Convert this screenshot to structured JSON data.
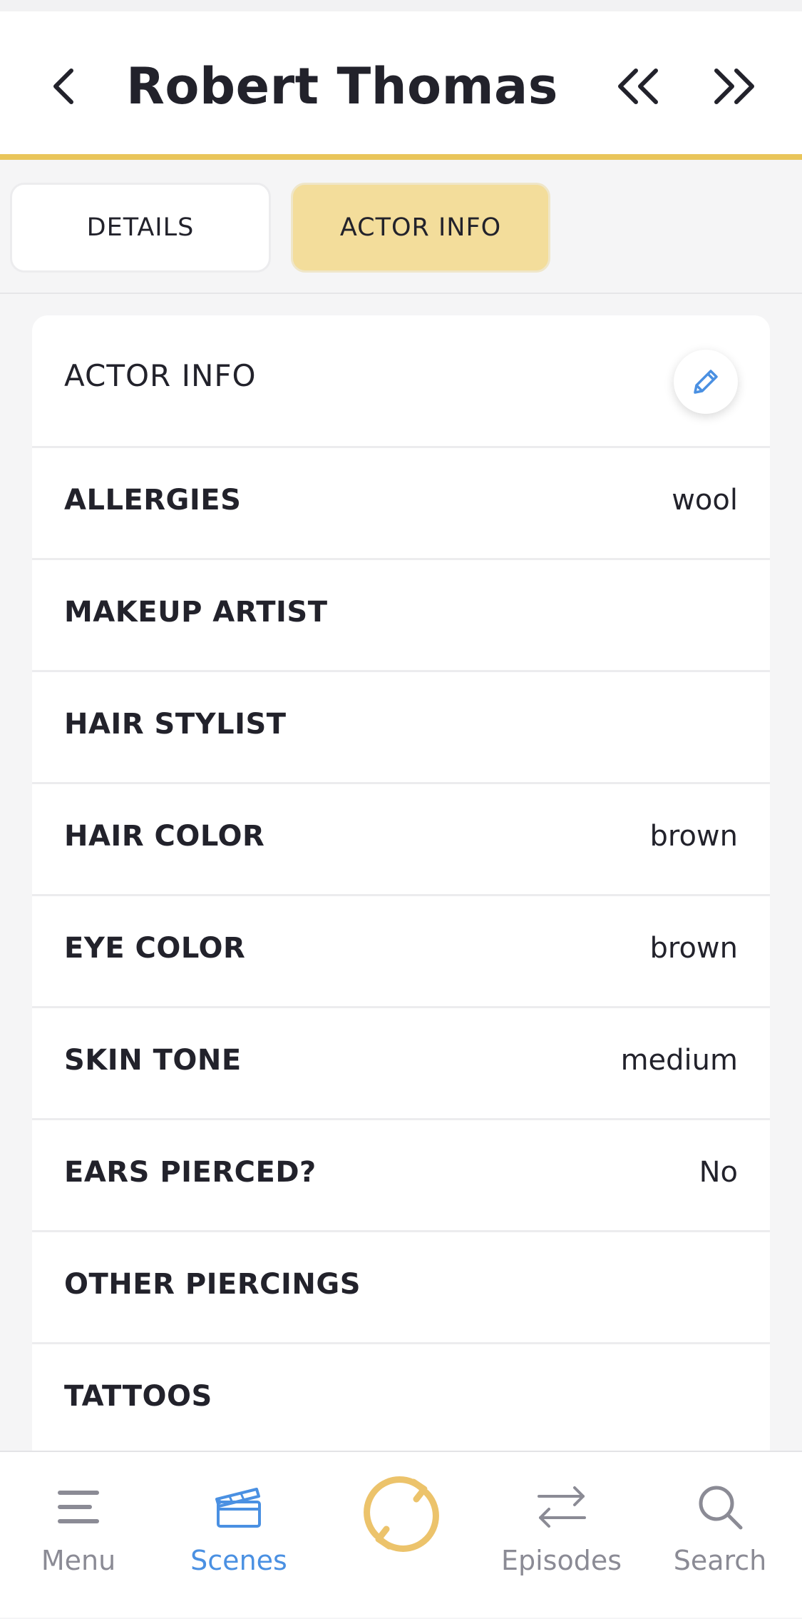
{
  "header": {
    "title": "Robert Thomas"
  },
  "tabs": [
    {
      "label": "DETAILS",
      "active": false
    },
    {
      "label": "ACTOR INFO",
      "active": true
    }
  ],
  "card": {
    "title": "ACTOR INFO",
    "rows": [
      {
        "label": "ALLERGIES",
        "value": "wool"
      },
      {
        "label": "MAKEUP ARTIST",
        "value": ""
      },
      {
        "label": "HAIR STYLIST",
        "value": ""
      },
      {
        "label": "HAIR COLOR",
        "value": "brown"
      },
      {
        "label": "EYE COLOR",
        "value": "brown"
      },
      {
        "label": "SKIN TONE",
        "value": "medium"
      },
      {
        "label": "EARS PIERCED?",
        "value": "No"
      },
      {
        "label": "OTHER PIERCINGS",
        "value": ""
      },
      {
        "label": "TATTOOS",
        "value": ""
      }
    ]
  },
  "bottom_nav": [
    {
      "label": "Menu",
      "icon": "menu-icon",
      "active": false
    },
    {
      "label": "Scenes",
      "icon": "clapperboard-icon",
      "active": true
    },
    {
      "label": "",
      "icon": "sync-icon",
      "active": false
    },
    {
      "label": "Episodes",
      "icon": "swap-arrows-icon",
      "active": false
    },
    {
      "label": "Search",
      "icon": "search-icon",
      "active": false
    }
  ],
  "colors": {
    "accent_gold": "#e9c55a",
    "active_tab": "#f3dd9b",
    "active_nav": "#4a90e2",
    "inactive_nav": "#8b8b95",
    "sync": "#ecc36b"
  }
}
